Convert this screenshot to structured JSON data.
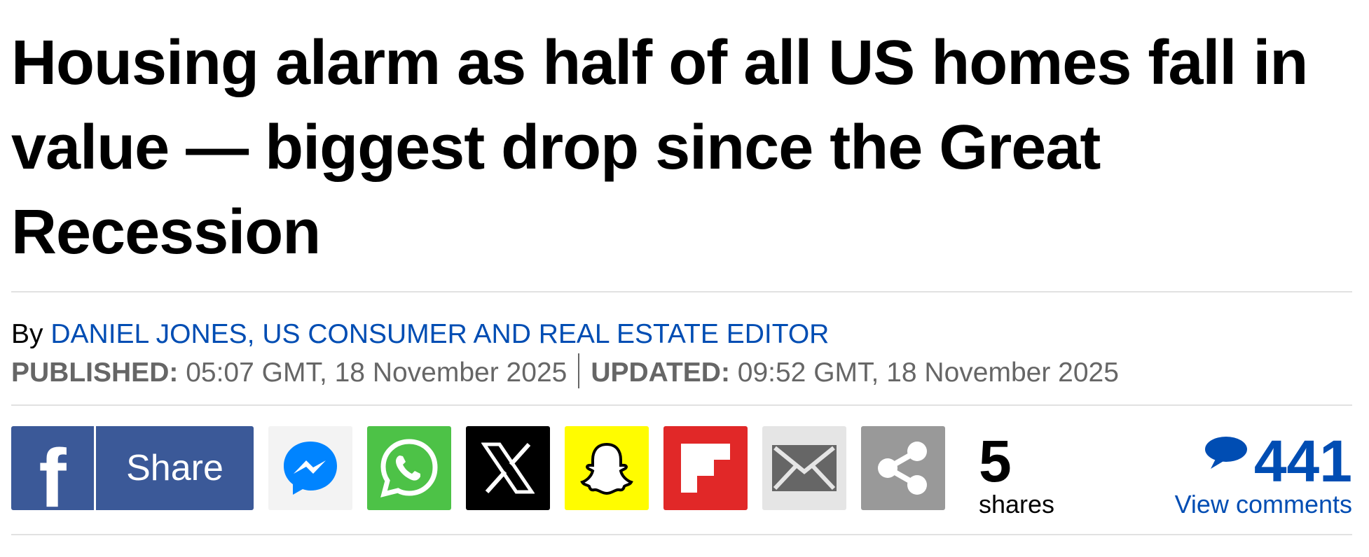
{
  "article": {
    "headline": "Housing alarm as half of all US homes fall in value — biggest drop since the Great Recession",
    "byline": {
      "prefix": "By",
      "author": "DANIEL JONES, US CONSUMER AND REAL ESTATE EDITOR"
    },
    "dates": {
      "published_label": "PUBLISHED:",
      "published_value": "05:07 GMT, 18 November 2025",
      "updated_label": "UPDATED:",
      "updated_value": "09:52 GMT, 18 November 2025"
    }
  },
  "share_bar": {
    "facebook_label": "Share",
    "buttons": [
      "facebook-icon",
      "messenger-icon",
      "whatsapp-icon",
      "x-icon",
      "snapchat-icon",
      "flipboard-icon",
      "email-icon",
      "share-icon"
    ],
    "share_count": "5",
    "share_count_label": "shares",
    "comment_count": "441",
    "comment_link": "View comments"
  },
  "colors": {
    "link": "#004db3",
    "facebook": "#3b5998",
    "messenger_bg": "#f3f3f3",
    "messenger_icon": "#0084ff",
    "whatsapp": "#4dc247",
    "x": "#000000",
    "snapchat": "#fffc00",
    "flipboard": "#e12828",
    "email": "#e5e5e5",
    "more": "#999999",
    "date_text": "#666666",
    "rule": "#e1e1e1"
  }
}
